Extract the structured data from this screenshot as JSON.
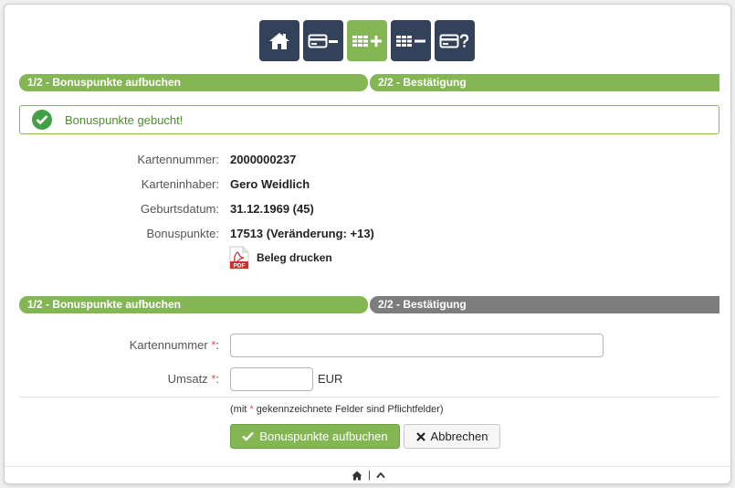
{
  "toolbar": {
    "buttons": [
      {
        "icon": "home-icon",
        "active": false
      },
      {
        "icon": "card-minus-icon",
        "active": false
      },
      {
        "icon": "grid-plus-icon",
        "active": true
      },
      {
        "icon": "grid-minus-icon",
        "active": false
      },
      {
        "icon": "card-question-icon",
        "active": false
      }
    ]
  },
  "steps_top": {
    "step1": "1/2 - Bonuspunkte aufbuchen",
    "step2": "2/2 - Bestätigung"
  },
  "alert": {
    "message": "Bonuspunkte gebucht!"
  },
  "info": {
    "rows": [
      {
        "label": "Kartennummer:",
        "value": "2000000237"
      },
      {
        "label": "Karteninhaber:",
        "value": "Gero Weidlich"
      },
      {
        "label": "Geburtsdatum:",
        "value": "31.12.1969 (45)"
      },
      {
        "label": "Bonuspunkte:",
        "value": "17513 (Veränderung: +13)"
      }
    ]
  },
  "print": {
    "label": "Beleg drucken",
    "icon_text": "PDF"
  },
  "steps_bottom": {
    "step1": "1/2 - Bonuspunkte aufbuchen",
    "step2": "2/2 - Bestätigung"
  },
  "form": {
    "card_label": "Kartennummer",
    "card_value": "",
    "amount_label": "Umsatz",
    "amount_value": "",
    "amount_unit": "EUR",
    "required_mark": "*",
    "label_suffix": ":"
  },
  "note": {
    "prefix": "(mit ",
    "mark": "*",
    "suffix": " gekennzeichnete Felder sind Pflichtfelder)"
  },
  "actions": {
    "submit_label": "Bonuspunkte aufbuchen",
    "cancel_label": "Abbrechen"
  },
  "footer": {
    "separator": "|"
  },
  "colors": {
    "accent": "#84b653",
    "dark": "#33425a",
    "grey_step": "#7d7d7d",
    "success": "#43a047"
  }
}
